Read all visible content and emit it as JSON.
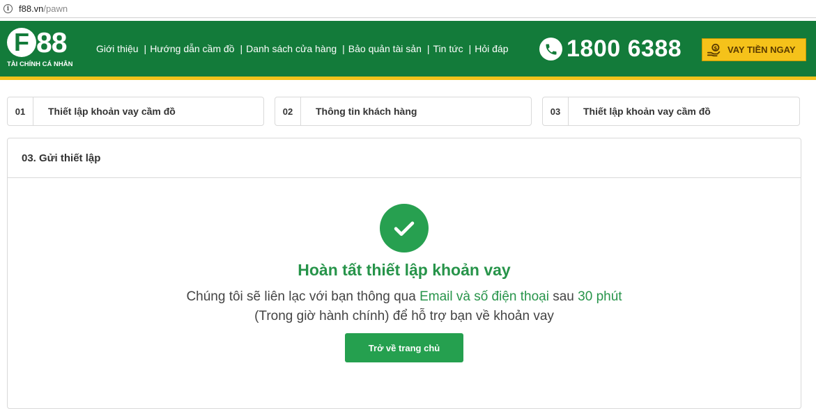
{
  "browser": {
    "url_host": "f88.vn",
    "url_path": "/pawn"
  },
  "header": {
    "logo_brand": "88",
    "logo_letter": "F",
    "logo_tagline": "TÀI CHÍNH CÁ NHÂN",
    "nav": [
      {
        "label": "Giới thiệu"
      },
      {
        "label": "Hướng dẫn cầm đồ"
      },
      {
        "label": "Danh sách cửa hàng"
      },
      {
        "label": "Bảo quản tài sản"
      },
      {
        "label": "Tin tức"
      },
      {
        "label": "Hỏi đáp"
      }
    ],
    "nav_separator": "|",
    "hotline": "1800 6388",
    "cta_label": "VAY TIỀN NGAY"
  },
  "steps": [
    {
      "num": "01",
      "title": "Thiết lập khoản vay cầm đồ"
    },
    {
      "num": "02",
      "title": "Thông tin khách hàng"
    },
    {
      "num": "03",
      "title": "Thiết lập khoản vay cầm đồ"
    }
  ],
  "panel": {
    "heading": "03. Gửi thiết lập",
    "success_title": "Hoàn tất thiết lập khoản vay",
    "msg_part1": "Chúng tôi sẽ liên lạc với bạn thông qua ",
    "msg_hl1": "Email và số điện thoại",
    "msg_part2": " sau ",
    "msg_hl2": "30 phút",
    "msg_part3": " (Trong giờ hành chính) để hỗ trợ bạn về khoản vay",
    "home_button": "Trở về trang chủ"
  },
  "colors": {
    "brand_green": "#137b3a",
    "accent_yellow": "#f1c21b",
    "success_green": "#27a050"
  },
  "icons": [
    "info-icon",
    "phone-icon",
    "hand-money-icon",
    "checkmark-icon"
  ]
}
